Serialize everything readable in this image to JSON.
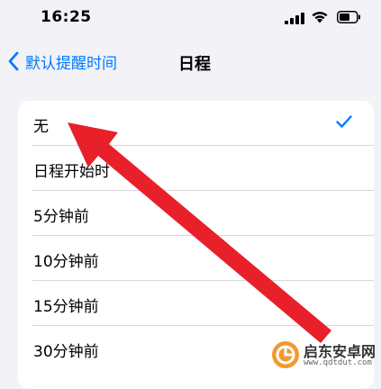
{
  "status_bar": {
    "time": "16:25",
    "icons": [
      "signal-icon",
      "wifi-icon",
      "battery-icon"
    ]
  },
  "nav": {
    "back_label": "默认提醒时间",
    "title": "日程"
  },
  "options": [
    {
      "label": "无",
      "selected": true
    },
    {
      "label": "日程开始时",
      "selected": false
    },
    {
      "label": "5分钟前",
      "selected": false
    },
    {
      "label": "10分钟前",
      "selected": false
    },
    {
      "label": "15分钟前",
      "selected": false
    },
    {
      "label": "30分钟前",
      "selected": false
    }
  ],
  "watermark": {
    "title": "启东安卓网",
    "url": "www.qdtdut.com"
  },
  "colors": {
    "accent": "#007aff",
    "annotation": "#e8202a",
    "background": "#f2f2f7"
  }
}
